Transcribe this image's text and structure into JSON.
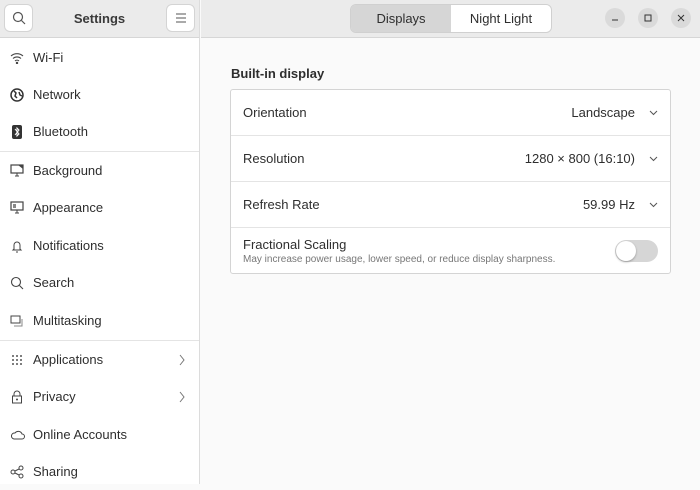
{
  "sidebar": {
    "title": "Settings",
    "items": [
      {
        "label": "Wi-Fi",
        "icon": "wifi-icon"
      },
      {
        "label": "Network",
        "icon": "globe-icon"
      },
      {
        "label": "Bluetooth",
        "icon": "bluetooth-icon"
      },
      {
        "label": "Background",
        "icon": "monitor-icon"
      },
      {
        "label": "Appearance",
        "icon": "appearance-icon"
      },
      {
        "label": "Notifications",
        "icon": "bell-icon"
      },
      {
        "label": "Search",
        "icon": "search-icon"
      },
      {
        "label": "Multitasking",
        "icon": "multitasking-icon"
      },
      {
        "label": "Applications",
        "icon": "grid-icon"
      },
      {
        "label": "Privacy",
        "icon": "lock-icon"
      },
      {
        "label": "Online Accounts",
        "icon": "cloud-icon"
      },
      {
        "label": "Sharing",
        "icon": "share-icon"
      }
    ]
  },
  "header": {
    "tabs": [
      "Displays",
      "Night Light"
    ],
    "active_tab": "Displays"
  },
  "main": {
    "section": "Built-in display",
    "rows": [
      {
        "label": "Orientation",
        "value": "Landscape"
      },
      {
        "label": "Resolution",
        "value": "1280 × 800 (16:10)"
      },
      {
        "label": "Refresh Rate",
        "value": "59.99 Hz"
      }
    ],
    "fractional": {
      "label": "Fractional Scaling",
      "description": "May increase power usage, lower speed, or reduce display sharpness.",
      "enabled": false
    }
  }
}
